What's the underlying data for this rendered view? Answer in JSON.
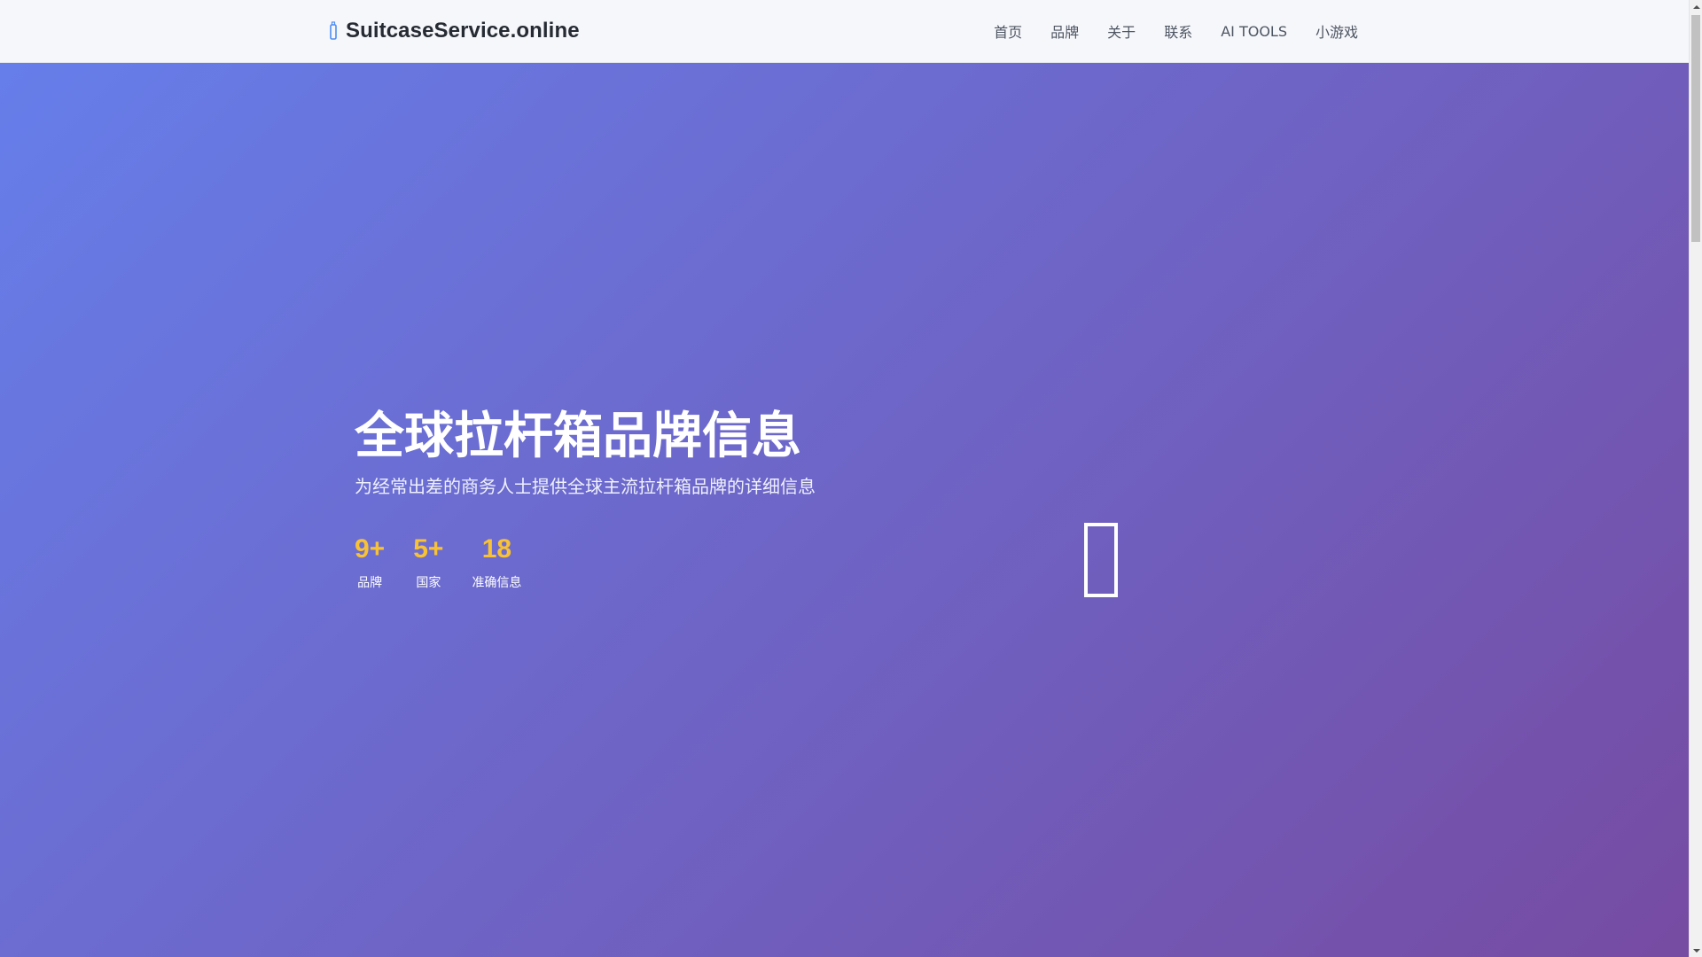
{
  "header": {
    "brand_icon": "suitcase-icon",
    "brand_title": "SuitcaseService.online",
    "nav": [
      {
        "label": "首页"
      },
      {
        "label": "品牌"
      },
      {
        "label": "关于"
      },
      {
        "label": "联系"
      },
      {
        "label": "AI TOOLS"
      },
      {
        "label": "小游戏"
      }
    ]
  },
  "hero": {
    "title": "全球拉杆箱品牌信息",
    "subtitle": "为经常出差的商务人士提供全球主流拉杆箱品牌的详细信息",
    "stats": [
      {
        "number": "9+",
        "label": "品牌"
      },
      {
        "number": "5+",
        "label": "国家"
      },
      {
        "number": "18",
        "label": "准确信息"
      }
    ],
    "icon": "suitcase-icon"
  },
  "colors": {
    "hero_gradient_start": "#667eea",
    "hero_gradient_end": "#764ba2",
    "accent": "#f8c234",
    "brand_icon": "#4f8ff0"
  }
}
